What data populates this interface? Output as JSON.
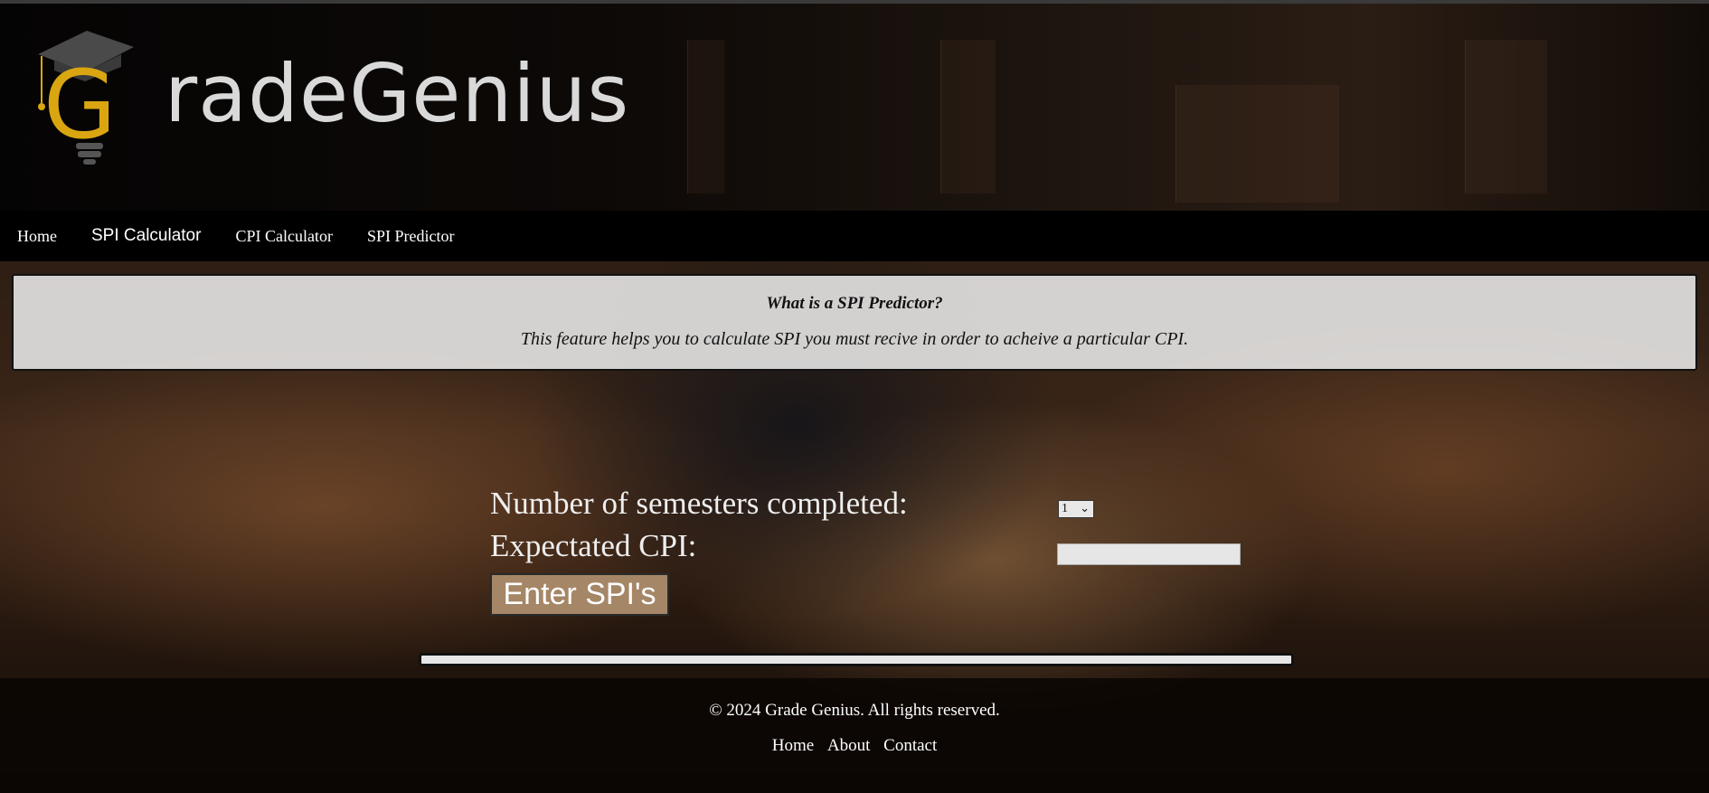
{
  "brand": {
    "name": "GradeGenius",
    "accent_color": "#d9a611",
    "text_color": "#d9d9d9"
  },
  "nav": {
    "items": [
      {
        "label": "Home"
      },
      {
        "label": "SPI Calculator"
      },
      {
        "label": "CPI Calculator"
      },
      {
        "label": "SPI Predictor"
      }
    ]
  },
  "info": {
    "title": "What is a SPI Predictor?",
    "text": "This feature helps you to calculate SPI you must recive in order to acheive a particular CPI."
  },
  "form": {
    "semesters_label": "Number of semesters completed:",
    "semesters_value": "1",
    "cpi_label": "Expectated CPI:",
    "cpi_value": "",
    "button_label": "Enter SPI's"
  },
  "footer": {
    "copyright": "© 2024 Grade Genius. All rights reserved.",
    "links": [
      {
        "label": "Home"
      },
      {
        "label": "About"
      },
      {
        "label": "Contact"
      }
    ]
  }
}
